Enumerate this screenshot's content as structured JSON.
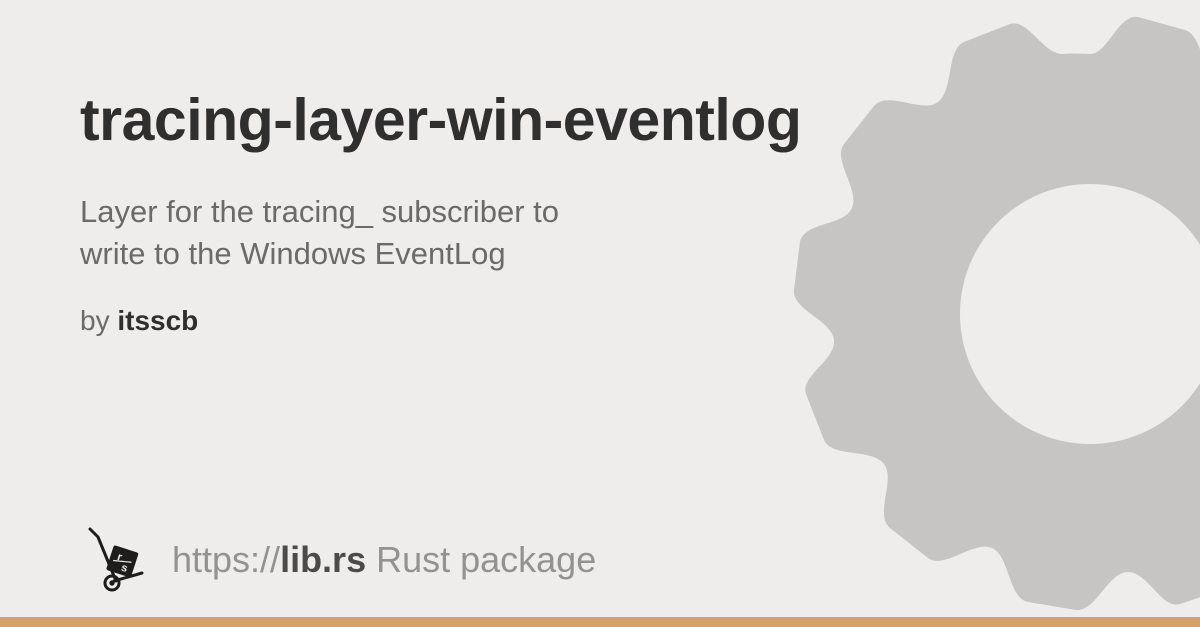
{
  "title": "tracing-layer-win-eventlog",
  "description": "Layer for the tracing_ subscriber to write to the Windows EventLog",
  "byline": {
    "by": "by ",
    "author": "itsscb"
  },
  "footer": {
    "url_prefix": "https://",
    "domain": "lib.rs",
    "suffix": " Rust package"
  },
  "icons": {
    "gear": "gear-icon",
    "logo": "librs-crate-icon"
  },
  "colors": {
    "accent": "#d6a06a",
    "background": "#eeedec",
    "gear": "#c7c5c3",
    "text_primary": "#2f2f2f",
    "text_muted": "#6c6a68"
  }
}
